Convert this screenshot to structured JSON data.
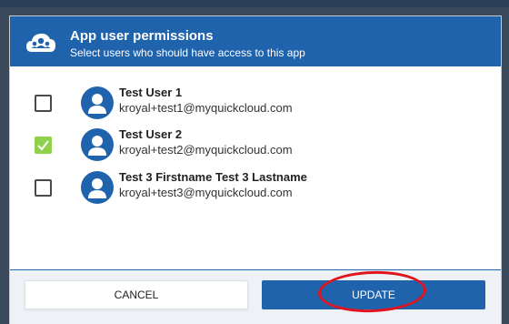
{
  "dialog": {
    "title": "App user permissions",
    "subtitle": "Select users who should have access to this app",
    "header_icon": "users-cloud-icon"
  },
  "users": [
    {
      "name": "Test User 1",
      "email": "kroyal+test1@myquickcloud.com",
      "checked": false
    },
    {
      "name": "Test User 2",
      "email": "kroyal+test2@myquickcloud.com",
      "checked": true
    },
    {
      "name": "Test 3 Firstname Test 3 Lastname",
      "email": "kroyal+test3@myquickcloud.com",
      "checked": false
    }
  ],
  "footer": {
    "cancel_label": "CANCEL",
    "update_label": "UPDATE"
  },
  "colors": {
    "primary": "#1f63ad",
    "checkbox_checked": "#8fd14a",
    "annotation": "#e0141e"
  }
}
